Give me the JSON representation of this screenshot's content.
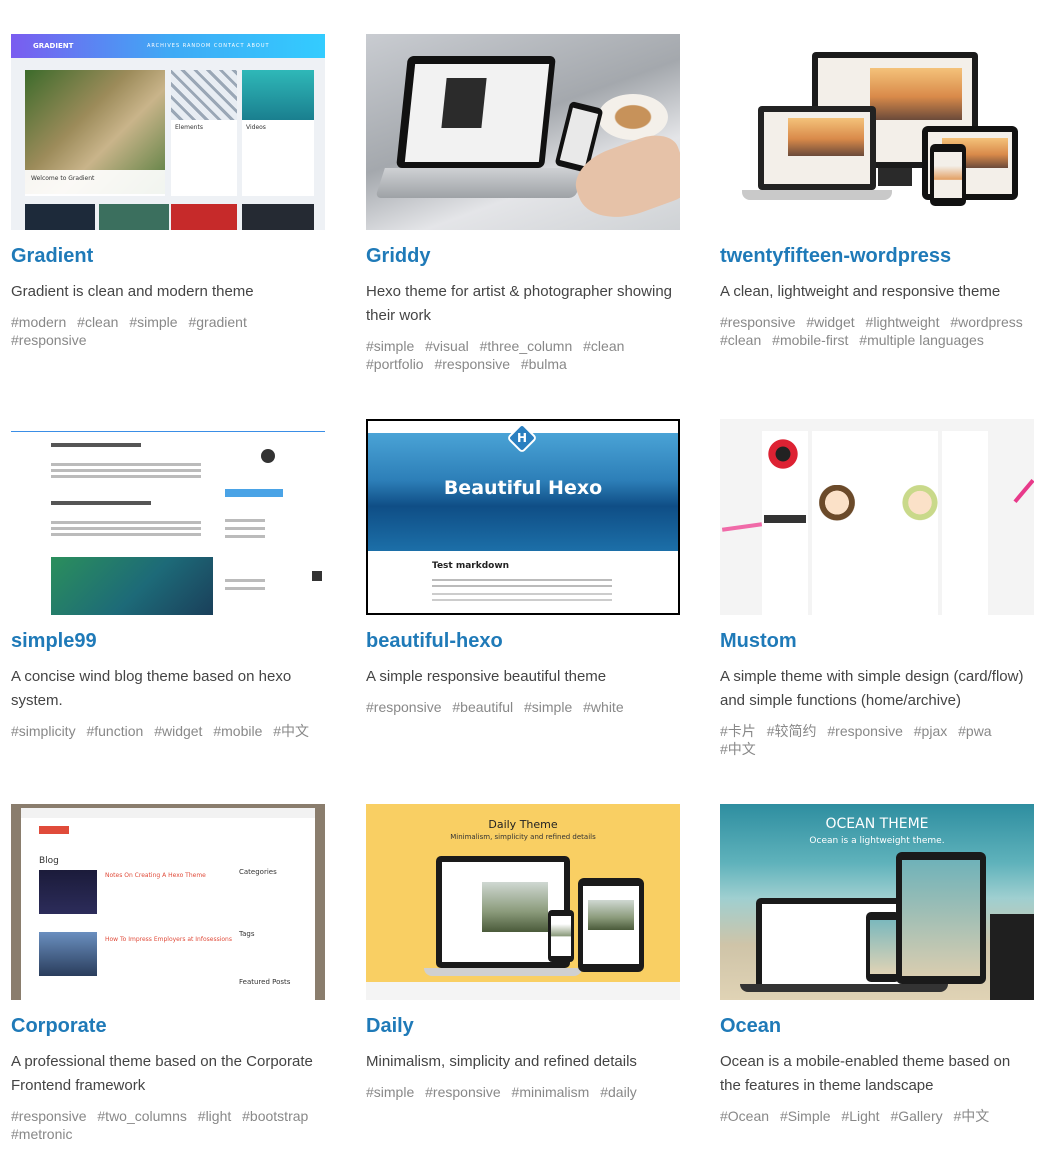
{
  "themes": [
    {
      "name": "Gradient",
      "description": "Gradient is clean and modern theme",
      "tags": [
        "#modern",
        "#clean",
        "#simple",
        "#gradient",
        "#responsive"
      ],
      "thumb": {
        "brand": "GRADIENT",
        "nav": "ARCHIVES  RANDOM  CONTACT  ABOUT",
        "post1": "Welcome to Gradient",
        "post2": "Elements",
        "post3": "Videos"
      }
    },
    {
      "name": "Griddy",
      "description": "Hexo theme for artist & photographer showing their work",
      "tags": [
        "#simple",
        "#visual",
        "#three_column",
        "#clean",
        "#portfolio",
        "#responsive",
        "#bulma"
      ],
      "thumb": {}
    },
    {
      "name": "twentyfifteen-wordpress",
      "description": "A clean, lightweight and responsive theme",
      "tags": [
        "#responsive",
        "#widget",
        "#lightweight",
        "#wordpress",
        "#clean",
        "#mobile-first",
        "#multiple languages"
      ],
      "thumb": {}
    },
    {
      "name": "simple99",
      "description": "A concise wind blog theme based on hexo system.",
      "tags": [
        "#simplicity",
        "#function",
        "#widget",
        "#mobile",
        "#中文"
      ],
      "thumb": {}
    },
    {
      "name": "beautiful-hexo",
      "description": "A simple responsive beautiful theme",
      "tags": [
        "#responsive",
        "#beautiful",
        "#simple",
        "#white"
      ],
      "thumb": {
        "hero_title": "Beautiful Hexo",
        "post_title": "Test markdown",
        "logo_letter": "H"
      }
    },
    {
      "name": "Mustom",
      "description": "A simple theme with simple design (card/flow) and simple functions (home/archive)",
      "tags": [
        "#卡片",
        "#较简约",
        "#responsive",
        "#pjax",
        "#pwa",
        "#中文"
      ],
      "thumb": {}
    },
    {
      "name": "Corporate",
      "description": "A professional theme based on the Corporate Frontend framework",
      "tags": [
        "#responsive",
        "#two_columns",
        "#light",
        "#bootstrap",
        "#metronic"
      ],
      "thumb": {
        "blog": "Blog",
        "post1": "Notes On Creating A Hexo Theme",
        "post2": "How To Impress Employers at Infosessions",
        "categories": "Categories",
        "tags_label": "Tags",
        "featured": "Featured Posts"
      }
    },
    {
      "name": "Daily",
      "description": "Minimalism, simplicity and refined details",
      "tags": [
        "#simple",
        "#responsive",
        "#minimalism",
        "#daily"
      ],
      "thumb": {
        "title": "Daily Theme",
        "subtitle": "Minimalism, simplicity and refined details"
      }
    },
    {
      "name": "Ocean",
      "description": "Ocean is a mobile-enabled theme based on the features in theme landscape",
      "tags": [
        "#Ocean",
        "#Simple",
        "#Light",
        "#Gallery",
        "#中文"
      ],
      "thumb": {
        "title": "OCEAN THEME",
        "subtitle": "Ocean is a lightweight theme."
      }
    }
  ],
  "colors": {
    "title": "#1f7ab8",
    "tag": "#888888",
    "description": "#444444"
  }
}
